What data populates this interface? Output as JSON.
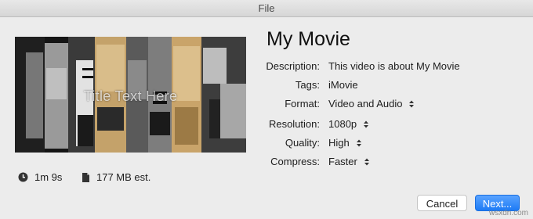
{
  "window": {
    "title": "File"
  },
  "preview": {
    "title_text": "Title Text Here"
  },
  "stats": {
    "duration": "1m 9s",
    "size": "177 MB est."
  },
  "movie": {
    "name": "My Movie"
  },
  "fields": [
    {
      "label": "Description:",
      "value": "This video is about My Movie",
      "control": "text"
    },
    {
      "label": "Tags:",
      "value": "iMovie",
      "control": "text"
    },
    {
      "label": "Format:",
      "value": "Video and Audio",
      "control": "popup"
    },
    {
      "label": "Resolution:",
      "value": "1080p",
      "control": "popup"
    },
    {
      "label": "Quality:",
      "value": "High",
      "control": "popup"
    },
    {
      "label": "Compress:",
      "value": "Faster",
      "control": "popup"
    }
  ],
  "buttons": {
    "cancel": "Cancel",
    "next": "Next..."
  },
  "watermark": "wsxdn.com",
  "colors": {
    "primary_button": "#1d7bf5",
    "window_bg": "#ececec"
  }
}
